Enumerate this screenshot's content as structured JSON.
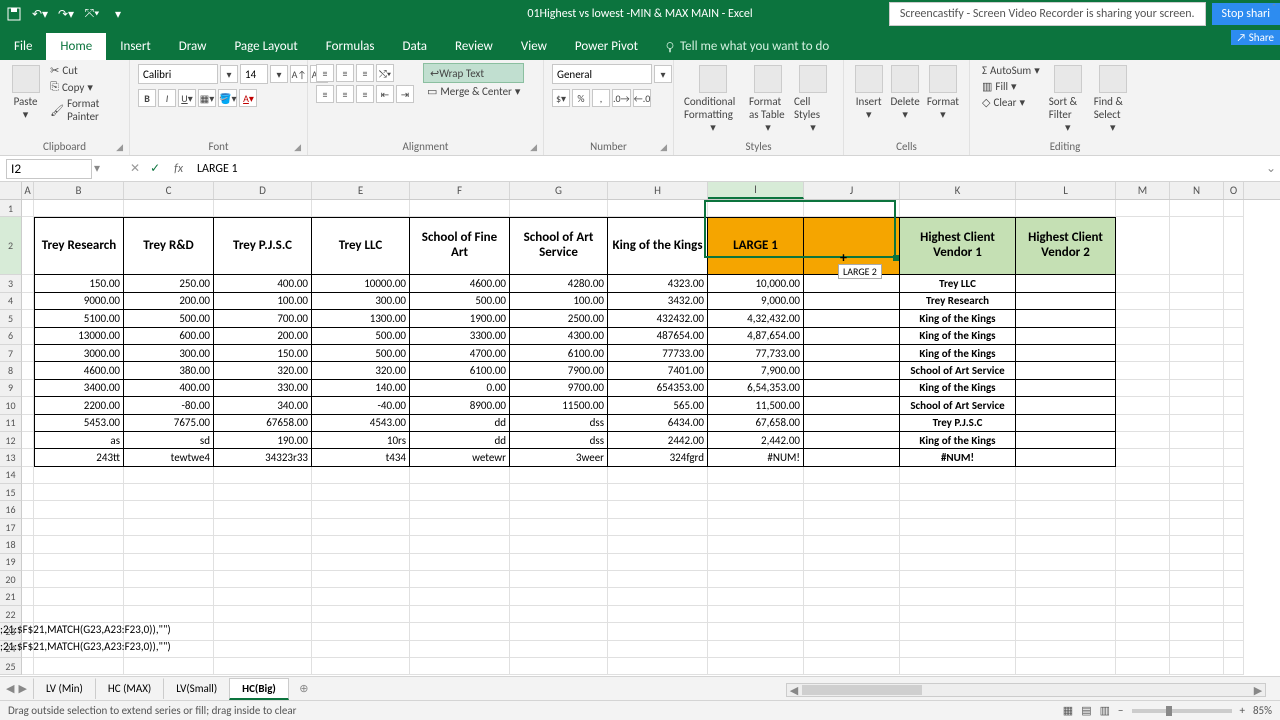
{
  "title": "01Highest vs lowest -MIN & MAX MAIN  -  Excel",
  "screencast_notif": "Screencastify - Screen Video Recorder is sharing your screen.",
  "stop_btn": "Stop shari",
  "share_badge": "Share",
  "tabs": [
    "File",
    "Home",
    "Insert",
    "Draw",
    "Page Layout",
    "Formulas",
    "Data",
    "Review",
    "View",
    "Power Pivot"
  ],
  "tell_me": "Tell me what you want to do",
  "ribbon": {
    "clipboard": {
      "paste": "Paste",
      "cut": "Cut",
      "copy": "Copy",
      "fp": "Format Painter",
      "label": "Clipboard"
    },
    "font": {
      "name": "Calibri",
      "size": "14",
      "label": "Font"
    },
    "alignment": {
      "wrap": "Wrap Text",
      "merge": "Merge & Center",
      "label": "Alignment"
    },
    "number": {
      "fmt": "General",
      "label": "Number"
    },
    "styles": {
      "cf": "Conditional Formatting",
      "fat": "Format as Table",
      "cs": "Cell Styles",
      "label": "Styles"
    },
    "cells": {
      "ins": "Insert",
      "del": "Delete",
      "fmt": "Format",
      "label": "Cells"
    },
    "editing": {
      "sum": "AutoSum",
      "fill": "Fill",
      "clear": "Clear",
      "sort": "Sort & Filter",
      "find": "Find & Select",
      "label": "Editing"
    }
  },
  "namebox": "I2",
  "formula_bar": "LARGE 1",
  "columns": [
    "A",
    "B",
    "C",
    "D",
    "E",
    "F",
    "G",
    "H",
    "I",
    "J",
    "K",
    "L",
    "M",
    "N",
    "O"
  ],
  "row_numbers_24": "24",
  "row_numbers_25": "25",
  "table": {
    "headers": {
      "B": "Trey Research",
      "C": "Trey R&D",
      "D": "Trey P.J.S.C",
      "E": "Trey LLC",
      "F": "School of Fine Art",
      "G": "School of Art Service",
      "H": "King of the Kings",
      "I": "LARGE 1",
      "J": "",
      "K": "Highest Client Vendor 1",
      "L": "Highest Client Vendor 2"
    },
    "rows": [
      {
        "B": "150.00",
        "C": "250.00",
        "D": "400.00",
        "E": "10000.00",
        "F": "4600.00",
        "G": "4280.00",
        "H": "4323.00",
        "I": "10,000.00",
        "J": "",
        "K": "Trey LLC",
        "L": ""
      },
      {
        "B": "9000.00",
        "C": "200.00",
        "D": "100.00",
        "E": "300.00",
        "F": "500.00",
        "G": "100.00",
        "H": "3432.00",
        "I": "9,000.00",
        "J": "",
        "K": "Trey Research",
        "L": ""
      },
      {
        "B": "5100.00",
        "C": "500.00",
        "D": "700.00",
        "E": "1300.00",
        "F": "1900.00",
        "G": "2500.00",
        "H": "432432.00",
        "I": "4,32,432.00",
        "J": "",
        "K": "King of the Kings",
        "L": ""
      },
      {
        "B": "13000.00",
        "C": "600.00",
        "D": "200.00",
        "E": "500.00",
        "F": "3300.00",
        "G": "4300.00",
        "H": "487654.00",
        "I": "4,87,654.00",
        "J": "",
        "K": "King of the Kings",
        "L": ""
      },
      {
        "B": "3000.00",
        "C": "300.00",
        "D": "150.00",
        "E": "500.00",
        "F": "4700.00",
        "G": "6100.00",
        "H": "77733.00",
        "I": "77,733.00",
        "J": "",
        "K": "King of the Kings",
        "L": ""
      },
      {
        "B": "4600.00",
        "C": "380.00",
        "D": "320.00",
        "E": "320.00",
        "F": "6100.00",
        "G": "7900.00",
        "H": "7401.00",
        "I": "7,900.00",
        "J": "",
        "K": "School of Art Service",
        "L": ""
      },
      {
        "B": "3400.00",
        "C": "400.00",
        "D": "330.00",
        "E": "140.00",
        "F": "0.00",
        "G": "9700.00",
        "H": "654353.00",
        "I": "6,54,353.00",
        "J": "",
        "K": "King of the Kings",
        "L": ""
      },
      {
        "B": "2200.00",
        "C": "-80.00",
        "D": "340.00",
        "E": "-40.00",
        "F": "8900.00",
        "G": "11500.00",
        "H": "565.00",
        "I": "11,500.00",
        "J": "",
        "K": "School of Art Service",
        "L": ""
      },
      {
        "B": "5453.00",
        "C": "7675.00",
        "D": "67658.00",
        "E": "4543.00",
        "F": "dd",
        "G": "dss",
        "H": "6434.00",
        "I": "67,658.00",
        "J": "",
        "K": "Trey P.J.S.C",
        "L": ""
      },
      {
        "B": "as",
        "C": "sd",
        "D": "190.00",
        "E": "10rs",
        "F": "dd",
        "G": "dss",
        "H": "2442.00",
        "I": "2,442.00",
        "J": "",
        "K": "King of the Kings",
        "L": ""
      },
      {
        "B": "243tt",
        "C": "tewtwe4",
        "D": "34323r33",
        "E": "t434",
        "F": "wetewr",
        "G": "3weer",
        "H": "324fgrd",
        "I": "#NUM!",
        "J": "",
        "K": "#NUM!",
        "L": ""
      }
    ]
  },
  "fill_tooltip": "LARGE 2",
  "formula_fragments": {
    "r24": ";21:$F$21,MATCH(G23,A23:F23,0)),\"\")",
    "r25": ";21:$F$21,MATCH(G23,A23:F23,0)),\"\")"
  },
  "sheet_tabs": [
    "LV (Min)",
    "HC (MAX)",
    "LV(Small)",
    "HC(Big)"
  ],
  "active_sheet": 3,
  "status_text": "Drag outside selection to extend series or fill; drag inside to clear",
  "zoom": "85%"
}
